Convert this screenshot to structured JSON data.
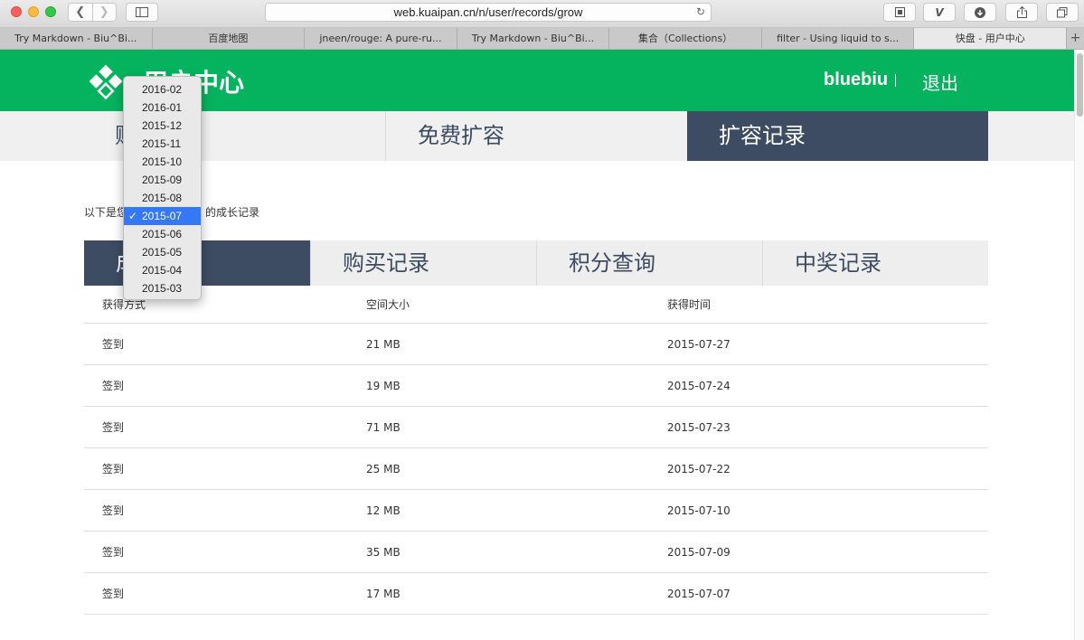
{
  "browser": {
    "url": "web.kuaipan.cn/n/user/records/grow",
    "tabs": [
      {
        "label": "Try Markdown - Biu^Bi...",
        "active": false
      },
      {
        "label": "百度地图",
        "active": false
      },
      {
        "label": "jneen/rouge: A pure-ru...",
        "active": false
      },
      {
        "label": "Try Markdown - Biu^Bi...",
        "active": false
      },
      {
        "label": "集合（Collections）",
        "active": false
      },
      {
        "label": "filter - Using liquid to s...",
        "active": false
      },
      {
        "label": "快盘 - 用户中心",
        "active": true
      }
    ],
    "add_tab": "+"
  },
  "header": {
    "title": "用户中心",
    "username": "bluebiu",
    "logout": "退出",
    "brand_color": "#05b35e"
  },
  "main_nav": [
    {
      "label": "账户信息",
      "active": false
    },
    {
      "label": "免费扩容",
      "active": false
    },
    {
      "label": "扩容记录",
      "active": true
    }
  ],
  "intro": {
    "prefix": "以下是您",
    "suffix": "的成长记录"
  },
  "sub_tabs": [
    {
      "label": "成长记录",
      "active": true
    },
    {
      "label": "购买记录",
      "active": false
    },
    {
      "label": "积分查询",
      "active": false
    },
    {
      "label": "中奖记录",
      "active": false
    }
  ],
  "table": {
    "headers": [
      "获得方式",
      "空间大小",
      "获得时间"
    ],
    "rows": [
      [
        "签到",
        "21 MB",
        "2015-07-27"
      ],
      [
        "签到",
        "19 MB",
        "2015-07-24"
      ],
      [
        "签到",
        "71 MB",
        "2015-07-23"
      ],
      [
        "签到",
        "25 MB",
        "2015-07-22"
      ],
      [
        "签到",
        "12 MB",
        "2015-07-10"
      ],
      [
        "签到",
        "35 MB",
        "2015-07-09"
      ],
      [
        "签到",
        "17 MB",
        "2015-07-07"
      ]
    ]
  },
  "month_select": {
    "selected": "2015-07",
    "options": [
      "2016-02",
      "2016-01",
      "2015-12",
      "2015-11",
      "2015-10",
      "2015-09",
      "2015-08",
      "2015-07",
      "2015-06",
      "2015-05",
      "2015-04",
      "2015-03"
    ]
  }
}
